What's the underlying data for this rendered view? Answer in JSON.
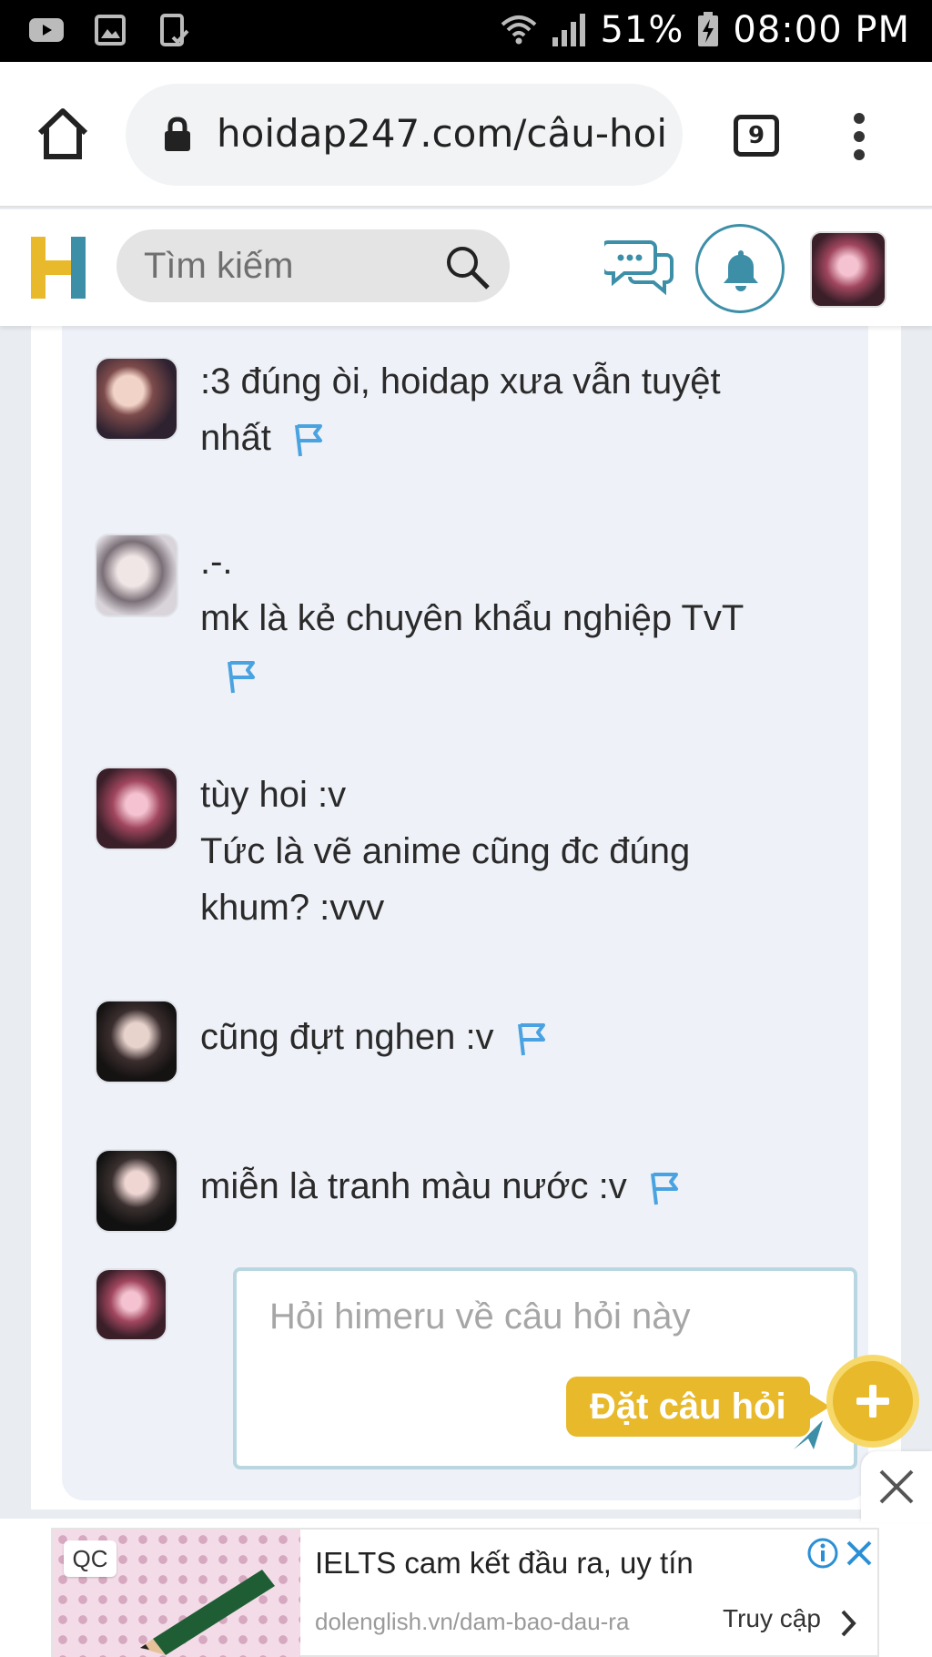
{
  "statusbar": {
    "battery": "51%",
    "time": "08:00 PM"
  },
  "browser": {
    "url": "hoidap247.com/câu-hoi",
    "tab_count": "9"
  },
  "header": {
    "search_placeholder": "Tìm kiếm"
  },
  "comments": [
    {
      "lines": [
        ":3 đúng òi, hoidap xưa vẫn tuyệt",
        "nhất"
      ],
      "has_flag": true
    },
    {
      "lines": [
        ".-.",
        "mk là kẻ chuyên khẩu nghiệp TvT"
      ],
      "has_flag": true
    },
    {
      "lines": [
        "tùy hoi :v",
        "Tức là vẽ anime cũng đc đúng",
        "khum? :vvv"
      ],
      "has_flag": false
    },
    {
      "lines": [
        "cũng đựt nghen :v"
      ],
      "has_flag": true
    },
    {
      "lines": [
        "miễn là tranh màu nước :v"
      ],
      "has_flag": true
    }
  ],
  "reply": {
    "placeholder": "Hỏi himeru về câu hỏi này"
  },
  "ask_button": {
    "label": "Đặt câu hỏi"
  },
  "ad": {
    "badge": "QC",
    "title": "IELTS cam kết đầu ra, uy tín",
    "url": "dolenglish.vn/dam-bao-dau-ra",
    "cta": "Truy cập"
  },
  "colors": {
    "brand_yellow": "#e8b92a",
    "brand_teal": "#3d8fa8",
    "flag_blue": "#4aa3e0"
  }
}
